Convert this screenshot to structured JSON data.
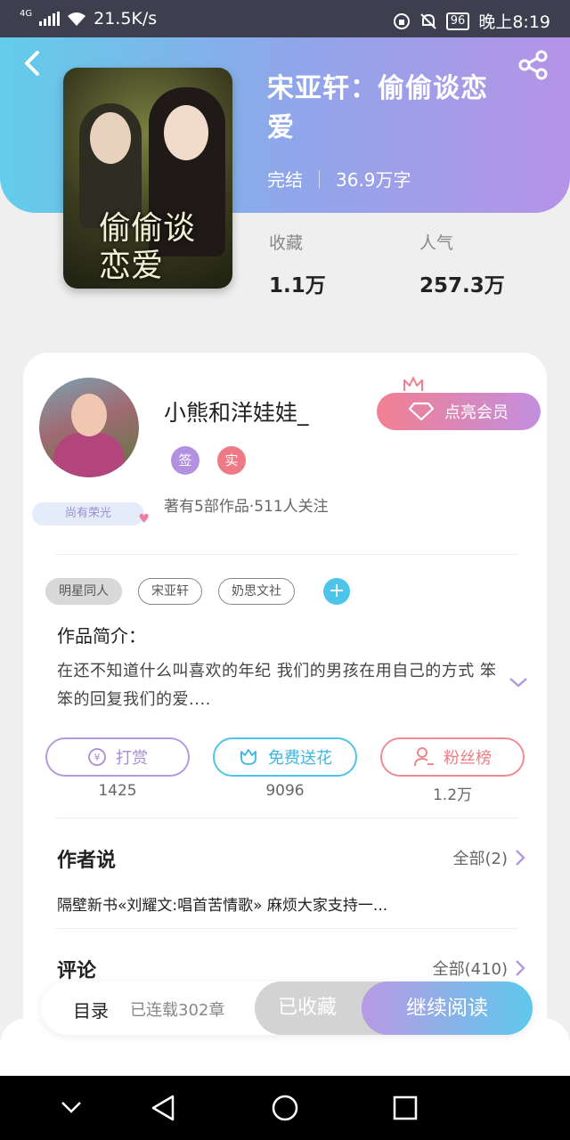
{
  "status": {
    "network": "4G",
    "speed": "21.5K/s",
    "battery": "96",
    "time": "晚上8:19"
  },
  "book": {
    "title": "宋亚轩：偷偷谈恋爱",
    "cover_title": "偷偷谈恋爱",
    "status": "完结",
    "words": "36.9万字",
    "favorites_label": "收藏",
    "favorites_value": "1.1万",
    "popularity_label": "人气",
    "popularity_value": "257.3万"
  },
  "author": {
    "name": "小熊和洋娃娃_",
    "badge_sign": "签",
    "badge_real": "实",
    "info": "著有5部作品·511人关注",
    "honor": "尚有荣光",
    "vip_label": "点亮会员"
  },
  "tags": [
    "明星同人",
    "宋亚轩",
    "奶思文社"
  ],
  "intro": {
    "heading": "作品简介：",
    "text": "在还不知道什么叫喜欢的年纪 我们的男孩在用自己的方式 笨笨的回复我们的爱...."
  },
  "actions": [
    {
      "label": "打赏",
      "count": "1425",
      "color": "#a98bd8",
      "icon": "yen-icon"
    },
    {
      "label": "免费送花",
      "count": "9096",
      "color": "#4fc4ea",
      "icon": "flower-icon"
    },
    {
      "label": "粉丝榜",
      "count": "1.2万",
      "color": "#ee7d84",
      "icon": "user-icon"
    }
  ],
  "author_says": {
    "heading": "作者说",
    "all": "全部(2)",
    "text": "隔壁新书«刘耀文:唱首苦情歌» 麻烦大家支持一..."
  },
  "comments": {
    "heading": "评论",
    "all": "全部(410)"
  },
  "bottom": {
    "toc": "目录",
    "serial": "已连载302章",
    "favorited": "已收藏",
    "continue": "继续阅读"
  }
}
